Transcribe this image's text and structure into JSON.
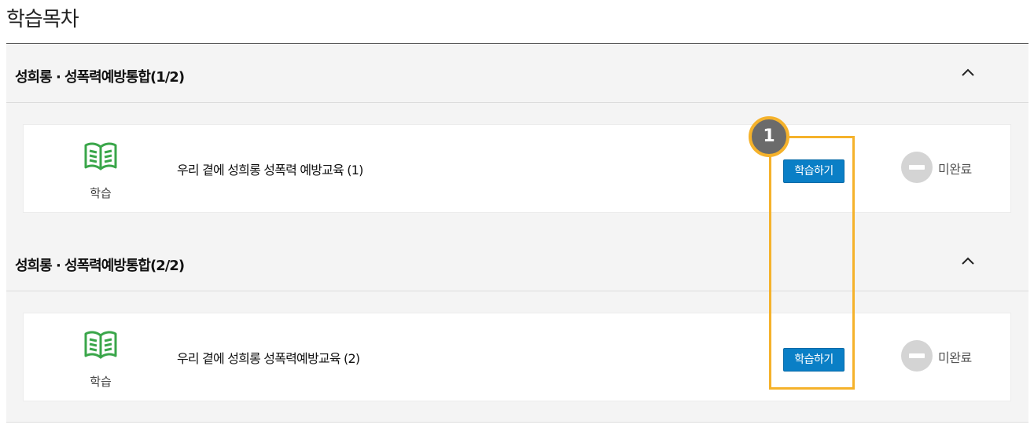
{
  "page": {
    "title": "학습목차"
  },
  "colors": {
    "accent": "#0a7fc6",
    "highlight": "#f5b22b",
    "icon_green": "#3aa64a"
  },
  "sections": [
    {
      "name": "성희롱 · 성폭력예방통합(1/2)",
      "toggle_icon": "chevron-up-icon",
      "lesson": {
        "type_icon": "open-book-icon",
        "type_label": "학습",
        "title": "우리 곁에 성희롱 성폭력 예방교육 (1)",
        "button_label": "학습하기",
        "status_icon": "minus-circle-icon",
        "status_label": "미완료"
      }
    },
    {
      "name": "성희롱 · 성폭력예방통합(2/2)",
      "toggle_icon": "chevron-up-icon",
      "lesson": {
        "type_icon": "open-book-icon",
        "type_label": "학습",
        "title": "우리 곁에 성희롱 성폭력예방교육 (2)",
        "button_label": "학습하기",
        "status_icon": "minus-circle-icon",
        "status_label": "미완료"
      }
    }
  ],
  "annotation": {
    "marker_label": "1"
  }
}
